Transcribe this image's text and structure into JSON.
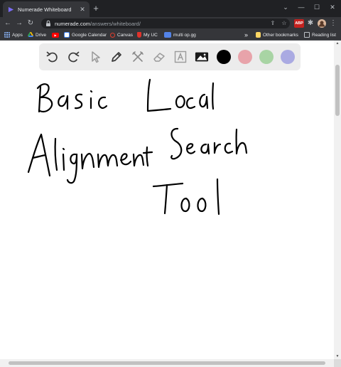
{
  "tab": {
    "title": "Numerade Whiteboard",
    "close": "✕",
    "new": "+"
  },
  "window": {
    "minimize": "—",
    "maximize": "☐",
    "close": "✕"
  },
  "nav": {
    "back": "←",
    "forward": "→",
    "reload": "↻"
  },
  "omnibox": {
    "host": "numerade.com",
    "path": "/answers/whiteboard/"
  },
  "extensions": {
    "abp": "ABP"
  },
  "bookmarks": {
    "items": [
      "Apps",
      "Drive",
      "",
      "Google Calendar",
      "Canvas",
      "My UC",
      "multi op.gg"
    ],
    "more": "»",
    "other": "Other bookmarks",
    "reading": "Reading list"
  },
  "toolbar": {
    "tools": [
      "undo-icon",
      "redo-icon",
      "pointer-icon",
      "pen-icon",
      "tools-icon",
      "eraser-icon",
      "text-icon",
      "image-icon"
    ],
    "colors": [
      "#000000",
      "#e8a3aa",
      "#a8d4a4",
      "#aaaae2"
    ]
  },
  "whiteboard": {
    "handwriting": [
      "Basic Local",
      "Alignment Search",
      "Tool"
    ]
  }
}
